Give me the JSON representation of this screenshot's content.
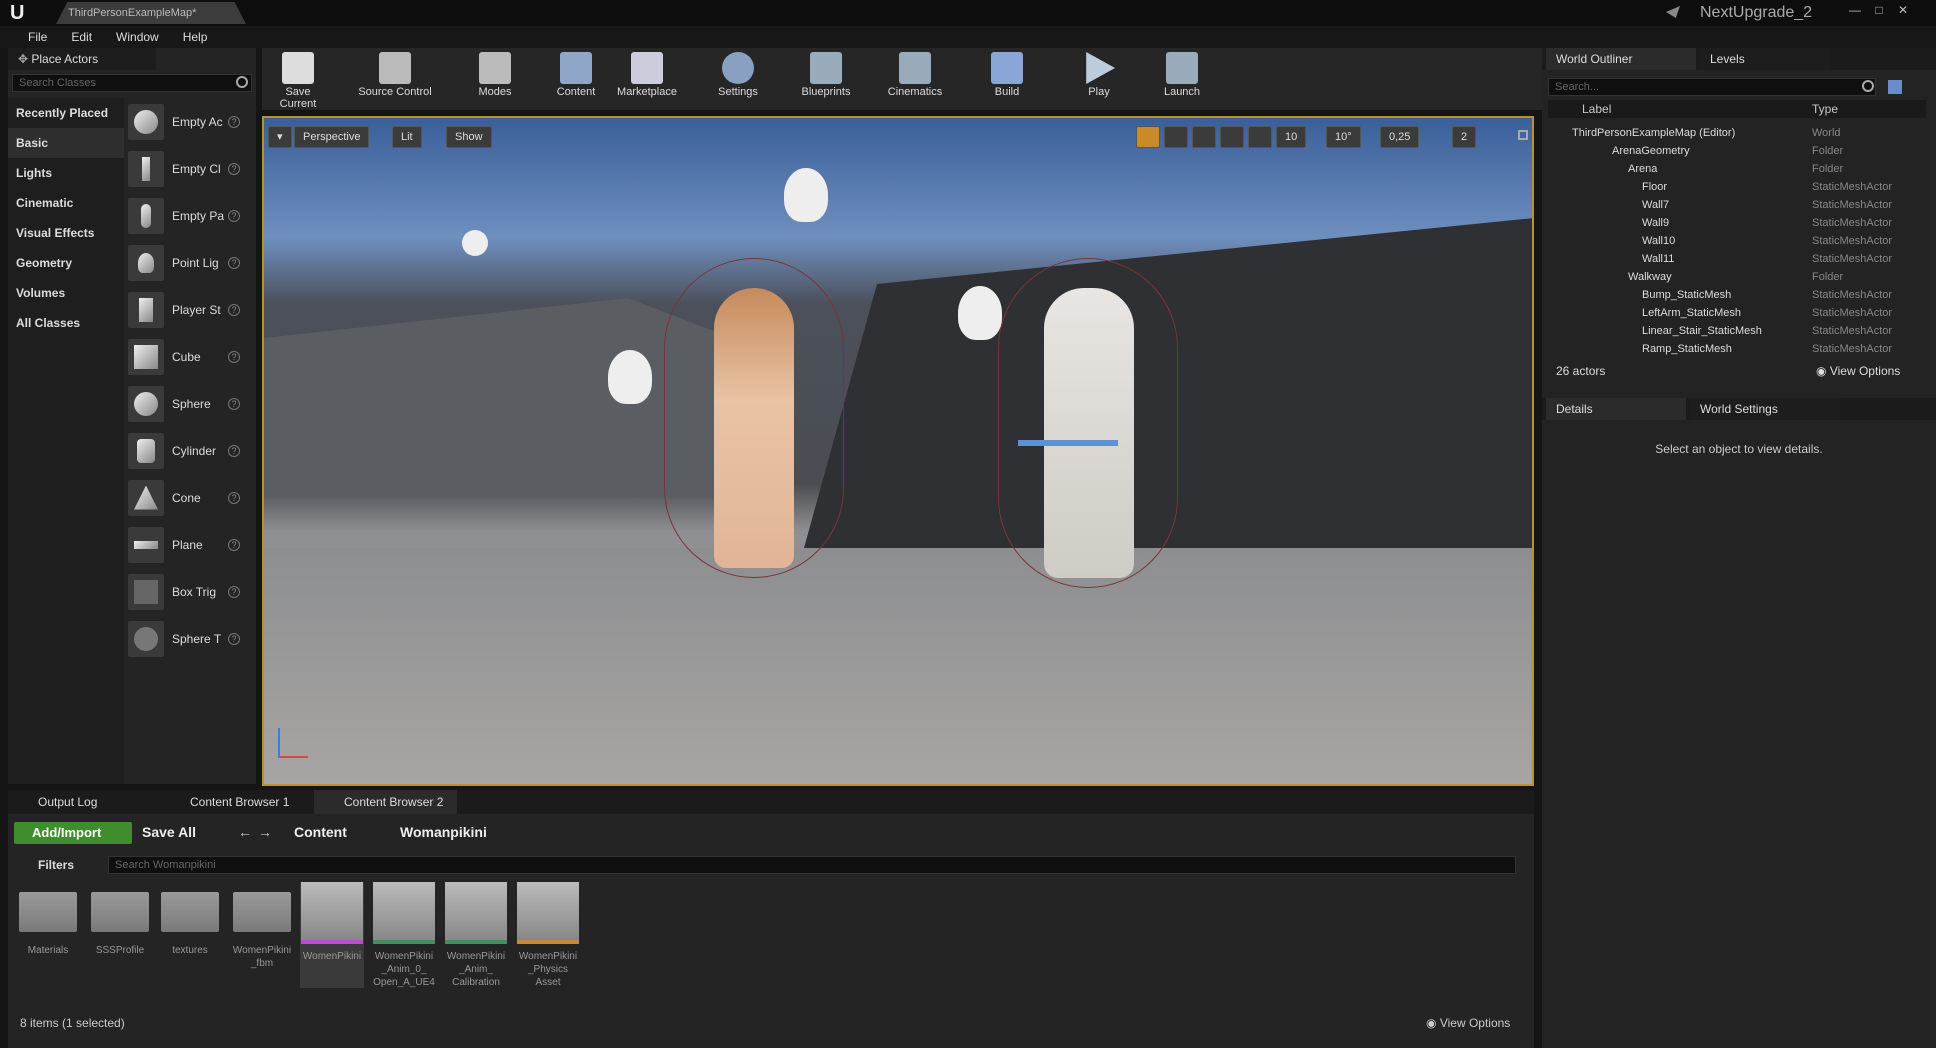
{
  "app": {
    "logo": "U",
    "doc_tab": "ThirdPersonExampleMap*",
    "project": "NextUpgrade_2"
  },
  "menu": [
    "File",
    "Edit",
    "Window",
    "Help"
  ],
  "place_actors": {
    "tab": "Place Actors",
    "search_placeholder": "Search Classes",
    "categories": [
      "Recently Placed",
      "Basic",
      "Lights",
      "Cinematic",
      "Visual Effects",
      "Geometry",
      "Volumes",
      "All Classes"
    ],
    "items": [
      "Empty Ac",
      "Empty Cl",
      "Empty Pa",
      "Point Lig",
      "Player St",
      "Cube",
      "Sphere",
      "Cylinder",
      "Cone",
      "Plane",
      "Box Trig",
      "Sphere T"
    ]
  },
  "toolbar": [
    "Save Current",
    "Source Control",
    "Modes",
    "Content",
    "Marketplace",
    "Settings",
    "Blueprints",
    "Cinematics",
    "Build",
    "Play",
    "Launch"
  ],
  "viewport": {
    "perspective": "Perspective",
    "lit": "Lit",
    "show": "Show",
    "grid_snap": "10",
    "rot_snap": "10°",
    "scale_snap": "0,25",
    "cam_speed": "2"
  },
  "outliner": {
    "tab": "World Outliner",
    "tab2": "Levels",
    "search_placeholder": "Search...",
    "col_label": "Label",
    "col_type": "Type",
    "rows": [
      {
        "label": "ThirdPersonExampleMap (Editor)",
        "type": "World",
        "indent": 0
      },
      {
        "label": "ArenaGeometry",
        "type": "Folder",
        "indent": 1
      },
      {
        "label": "Arena",
        "type": "Folder",
        "indent": 2
      },
      {
        "label": "Floor",
        "type": "StaticMeshActor",
        "indent": 3
      },
      {
        "label": "Wall7",
        "type": "StaticMeshActor",
        "indent": 3
      },
      {
        "label": "Wall9",
        "type": "StaticMeshActor",
        "indent": 3
      },
      {
        "label": "Wall10",
        "type": "StaticMeshActor",
        "indent": 3
      },
      {
        "label": "Wall11",
        "type": "StaticMeshActor",
        "indent": 3
      },
      {
        "label": "Walkway",
        "type": "Folder",
        "indent": 2
      },
      {
        "label": "Bump_StaticMesh",
        "type": "StaticMeshActor",
        "indent": 3
      },
      {
        "label": "LeftArm_StaticMesh",
        "type": "StaticMeshActor",
        "indent": 3
      },
      {
        "label": "Linear_Stair_StaticMesh",
        "type": "StaticMeshActor",
        "indent": 3
      },
      {
        "label": "Ramp_StaticMesh",
        "type": "StaticMeshActor",
        "indent": 3
      }
    ],
    "count": "26 actors",
    "view_options": "View Options"
  },
  "details": {
    "tab": "Details",
    "tab2": "World Settings",
    "empty": "Select an object to view details."
  },
  "bottom": {
    "tabs": [
      "Output Log",
      "Content Browser 1",
      "Content Browser 2"
    ],
    "add_import": "Add/Import",
    "save_all": "Save All",
    "path": [
      "Content",
      "Womanpikini"
    ],
    "filters": "Filters",
    "search_placeholder": "Search Womanpikini",
    "assets": [
      {
        "name": "Materials",
        "kind": "folder"
      },
      {
        "name": "SSSProfile",
        "kind": "folder"
      },
      {
        "name": "textures",
        "kind": "folder"
      },
      {
        "name": "WomenPikini _fbm",
        "kind": "folder"
      },
      {
        "name": "WomenPikini",
        "kind": "mesh",
        "selected": true
      },
      {
        "name": "WomenPikini _Anim_0_ Open_A_UE4",
        "kind": "mesh"
      },
      {
        "name": "WomenPikini _Anim_ Calibration",
        "kind": "mesh"
      },
      {
        "name": "WomenPikini _Physics Asset",
        "kind": "mesh"
      }
    ],
    "status": "8 items (1 selected)",
    "view_options": "View Options"
  }
}
